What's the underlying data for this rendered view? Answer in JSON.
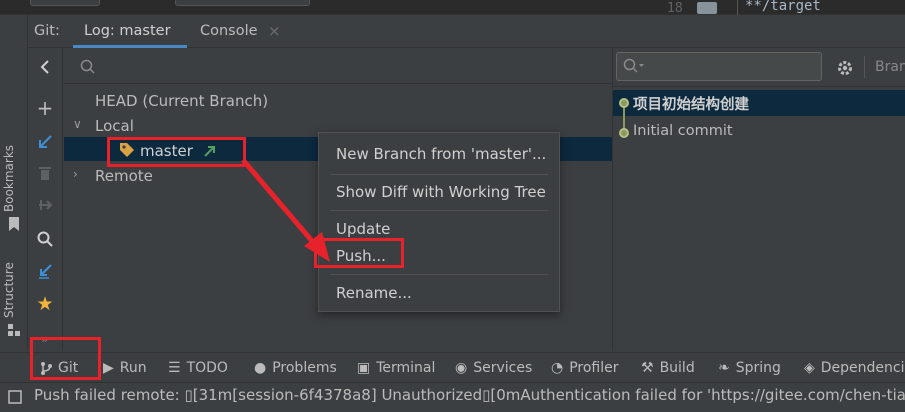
{
  "editor_strip": {
    "line_number": "18",
    "code_text": "**/target"
  },
  "git_panel": {
    "prefix": "Git:",
    "tabs": [
      {
        "label": "Log: master",
        "active": true
      },
      {
        "label": "Console",
        "active": false
      }
    ]
  },
  "side_labels": {
    "bookmarks": "Bookmarks",
    "structure": "Structure"
  },
  "branch_tree": {
    "head": "HEAD (Current Branch)",
    "local": "Local",
    "master": "master",
    "remote": "Remote"
  },
  "commits_panel": {
    "filter_placeholder": "",
    "branch_filter": "Bran",
    "commits": [
      {
        "message": "项目初始结构创建",
        "selected": true
      },
      {
        "message": "Initial commit",
        "selected": false
      }
    ]
  },
  "context_menu": {
    "new_branch": "New Branch from 'master'...",
    "show_diff": "Show Diff with Working Tree",
    "update": "Update",
    "push": "Push...",
    "rename": "Rename..."
  },
  "bottom_tabs": {
    "git": "Git",
    "run": "Run",
    "todo": "TODO",
    "problems": "Problems",
    "terminal": "Terminal",
    "services": "Services",
    "profiler": "Profiler",
    "build": "Build",
    "spring": "Spring",
    "dependencies": "Dependencie"
  },
  "status": {
    "message": "Push failed remote: ▯[31m[session-6f4378a8] Unauthorized▯[0mAuthentication failed for 'https://gitee.com/chen-tianxi/"
  },
  "colors": {
    "background": "#3c3f41",
    "selection": "#0d293e",
    "annotation": "#e8222a",
    "accent": "#4a88c7"
  }
}
